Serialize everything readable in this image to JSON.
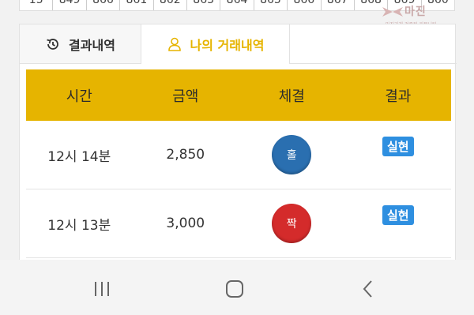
{
  "top_strip": {
    "numbers": [
      "15",
      "849",
      "866",
      "861",
      "862",
      "863",
      "864",
      "865",
      "866",
      "867",
      "868",
      "869",
      "860"
    ]
  },
  "watermark": {
    "logo_text": "마진",
    "sub_text": "마진거래 검증된 커뮤니티"
  },
  "tabs": [
    {
      "label": "결과내역",
      "icon": "history-icon",
      "active": false
    },
    {
      "label": "나의 거래내역",
      "icon": "user-icon",
      "active": true
    }
  ],
  "table": {
    "headers": [
      "시간",
      "금액",
      "체결",
      "결과"
    ],
    "rows": [
      {
        "time": "12시 14분",
        "amount": "2,850",
        "pick": "홀",
        "pick_color": "#2a6fb0",
        "result": "실현"
      },
      {
        "time": "12시 13분",
        "amount": "3,000",
        "pick": "짝",
        "pick_color": "#d42b2b",
        "result": "실현"
      }
    ]
  },
  "colors": {
    "accent": "#e6b400",
    "badge": "#2e8fe0",
    "odd": "#2a6fb0",
    "even": "#d42b2b"
  }
}
